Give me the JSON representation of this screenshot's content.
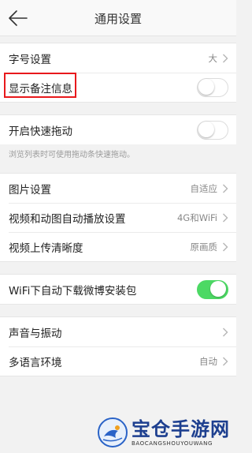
{
  "navbar": {
    "title": "通用设置"
  },
  "group1": {
    "font_size_label": "字号设置",
    "font_size_value": "大",
    "show_notes_label": "显示备注信息",
    "show_notes_on": false
  },
  "group2": {
    "fast_drag_label": "开启快速拖动",
    "fast_drag_on": false,
    "fast_drag_hint": "浏览列表时可使用拖动条快速拖动。"
  },
  "group3": {
    "image_label": "图片设置",
    "image_value": "自适应",
    "autoplay_label": "视频和动图自动播放设置",
    "autoplay_value": "4G和WiFi",
    "upload_quality_label": "视频上传清晰度",
    "upload_quality_value": "原画质"
  },
  "group4": {
    "wifi_download_label": "WiFi下自动下载微博安装包",
    "wifi_download_on": true
  },
  "group5": {
    "sound_label": "声音与振动",
    "language_label": "多语言环境",
    "language_value": "自动"
  },
  "watermark": {
    "main": "宝仓手游网",
    "sub": "BAOCANGSHOUYOUWANG"
  },
  "colors": {
    "toggle_on": "#4cd964",
    "highlight": "#e8191c",
    "watermark": "#1d3f8f"
  },
  "icons": {
    "back": "arrow-left-icon",
    "chevron": "chevron-right-icon"
  }
}
